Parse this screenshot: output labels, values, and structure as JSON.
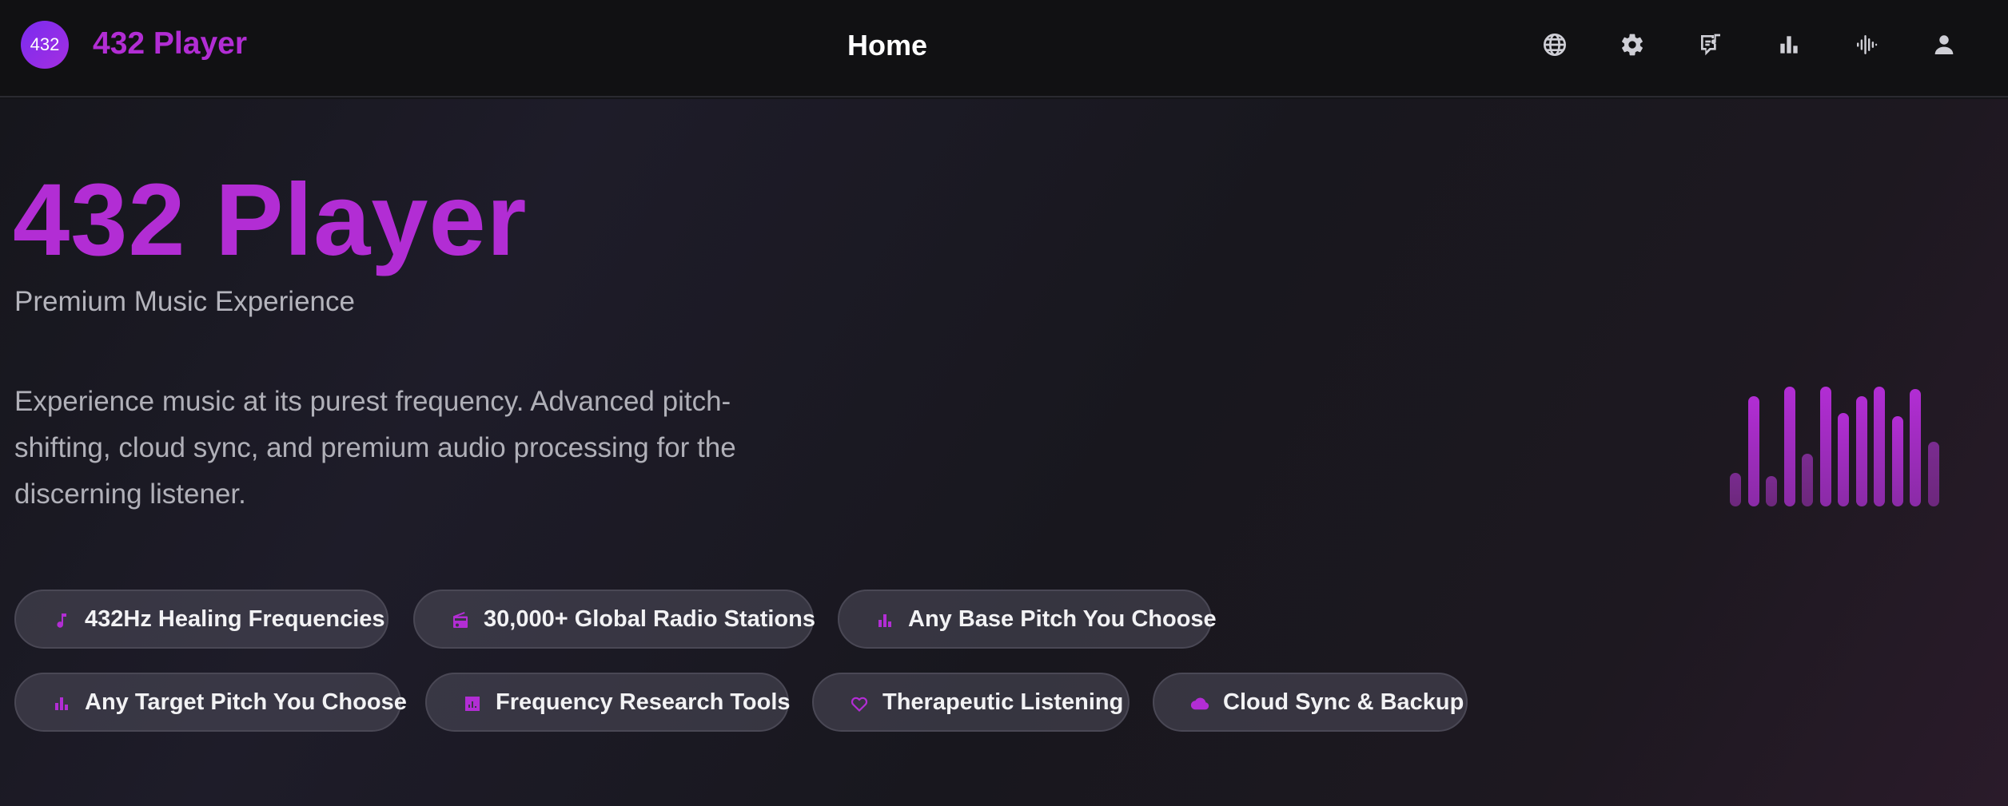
{
  "header": {
    "logo_text": "432",
    "app_name": "432 Player",
    "page_title": "Home",
    "icons": [
      "globe-icon",
      "settings-gear-icon",
      "feedback-music-icon",
      "stats-bar-chart-icon",
      "waveform-icon",
      "user-account-icon"
    ]
  },
  "hero": {
    "title": "432 Player",
    "subtitle": "Premium Music Experience",
    "description": "Experience music at its purest frequency. Advanced pitch-shifting, cloud sync, and premium audio processing for the discerning listener."
  },
  "features": [
    {
      "label": "432Hz Healing Frequencies",
      "icon": "music-note-icon"
    },
    {
      "label": "30,000+ Global Radio Stations",
      "icon": "radio-icon"
    },
    {
      "label": "Any Base Pitch You Choose",
      "icon": "bar-chart-icon"
    },
    {
      "label": "Any Target Pitch You Choose",
      "icon": "bar-chart-icon"
    },
    {
      "label": "Frequency Research Tools",
      "icon": "chart-box-icon"
    },
    {
      "label": "Therapeutic Listening",
      "icon": "heart-icon"
    },
    {
      "label": "Cloud Sync & Backup",
      "icon": "cloud-icon"
    }
  ],
  "visualizer": {
    "levels": [
      0.28,
      0.92,
      0.25,
      1.0,
      0.44,
      1.0,
      0.78,
      0.92,
      1.0,
      0.75,
      0.98,
      0.54
    ]
  },
  "colors": {
    "accent": "#b22dd4",
    "accent_soft": "#7a2a8c",
    "background": "#141418",
    "header_bg": "#111113"
  }
}
